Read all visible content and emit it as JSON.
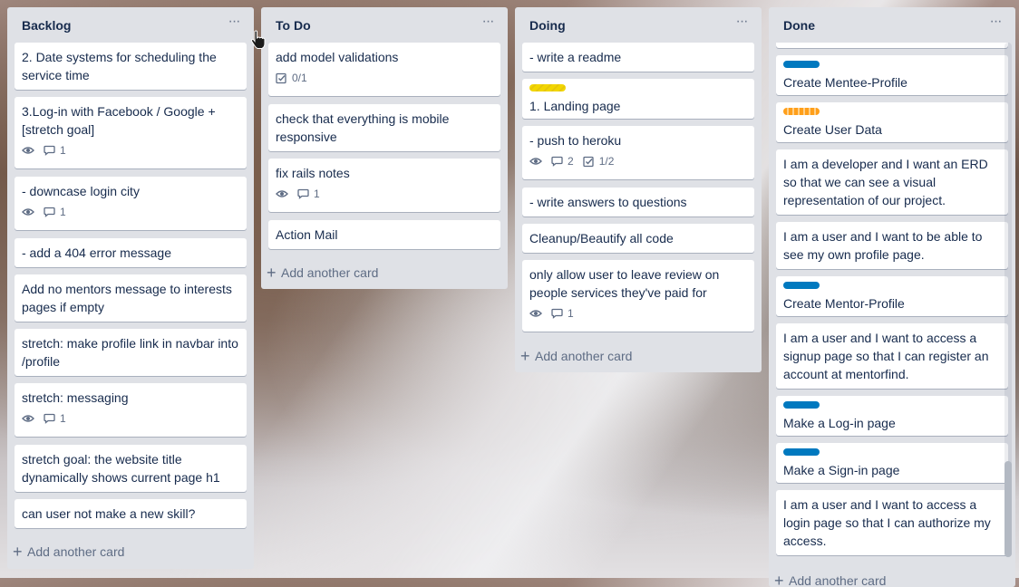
{
  "colors": {
    "list_bg": "#dfe1e6",
    "card_bg": "#ffffff",
    "label_blue": "#0079bf",
    "label_yellow": "#f2d600",
    "label_orange": "#ff9f1a",
    "muted_text": "#5e6c84"
  },
  "icons": {
    "menu": "ellipsis-icon",
    "watch": "eye-icon",
    "comments": "comment-icon",
    "checklist": "checkbox-icon",
    "add": "plus-icon",
    "cursor": "hand-pointer-icon"
  },
  "lists": [
    {
      "title": "Backlog",
      "menu_glyph": "···",
      "add_label": "Add another card",
      "cards": [
        {
          "title": "2. Date systems for scheduling the service time"
        },
        {
          "title": "3.Log-in with Facebook / Google + [stretch goal]",
          "watch": true,
          "comments": "1"
        },
        {
          "title": "- downcase login city",
          "watch": true,
          "comments": "1"
        },
        {
          "title": "- add a 404 error message"
        },
        {
          "title": "Add no mentors message to interests pages if empty"
        },
        {
          "title": "stretch: make profile link in navbar into /profile"
        },
        {
          "title": "stretch: messaging",
          "watch": true,
          "comments": "1"
        },
        {
          "title": "stretch goal: the website title dynamically shows current page h1"
        },
        {
          "title": "can user not make a new skill?"
        }
      ]
    },
    {
      "title": "To Do",
      "menu_glyph": "···",
      "add_label": "Add another card",
      "cards": [
        {
          "title": "add model validations",
          "checklist": "0/1"
        },
        {
          "title": "check that everything is mobile responsive"
        },
        {
          "title": "fix rails notes",
          "watch": true,
          "comments": "1"
        },
        {
          "title": "Action Mail"
        }
      ]
    },
    {
      "title": "Doing",
      "menu_glyph": "···",
      "add_label": "Add another card",
      "cards": [
        {
          "title": "- write a readme"
        },
        {
          "title": "1. Landing page",
          "label": "yellow"
        },
        {
          "title": "- push to heroku",
          "watch": true,
          "comments": "2",
          "checklist": "1/2"
        },
        {
          "title": "- write answers to questions"
        },
        {
          "title": "Cleanup/Beautify all code"
        },
        {
          "title": "only allow user to leave review on people services they've paid for",
          "watch": true,
          "comments": "1"
        }
      ]
    },
    {
      "title": "Done",
      "menu_glyph": "···",
      "add_label": "Add another card",
      "cards": [
        {
          "title": "Create Mentee-Profile",
          "label": "blue"
        },
        {
          "title": "Create User Data",
          "label": "orange"
        },
        {
          "title": "I am a developer and I want an ERD so that we can see a visual representation of our project."
        },
        {
          "title": "I am a user and I want to be able to see my own profile page."
        },
        {
          "title": "Create Mentor-Profile",
          "label": "blue"
        },
        {
          "title": "I am a user and I want to access a signup page so that I can register an account at mentorfind."
        },
        {
          "title": "Make a Log-in page",
          "label": "blue"
        },
        {
          "title": "Make a Sign-in page",
          "label": "blue"
        },
        {
          "title": "I am a user and I want to access a login page so that I can authorize my access."
        }
      ]
    }
  ]
}
